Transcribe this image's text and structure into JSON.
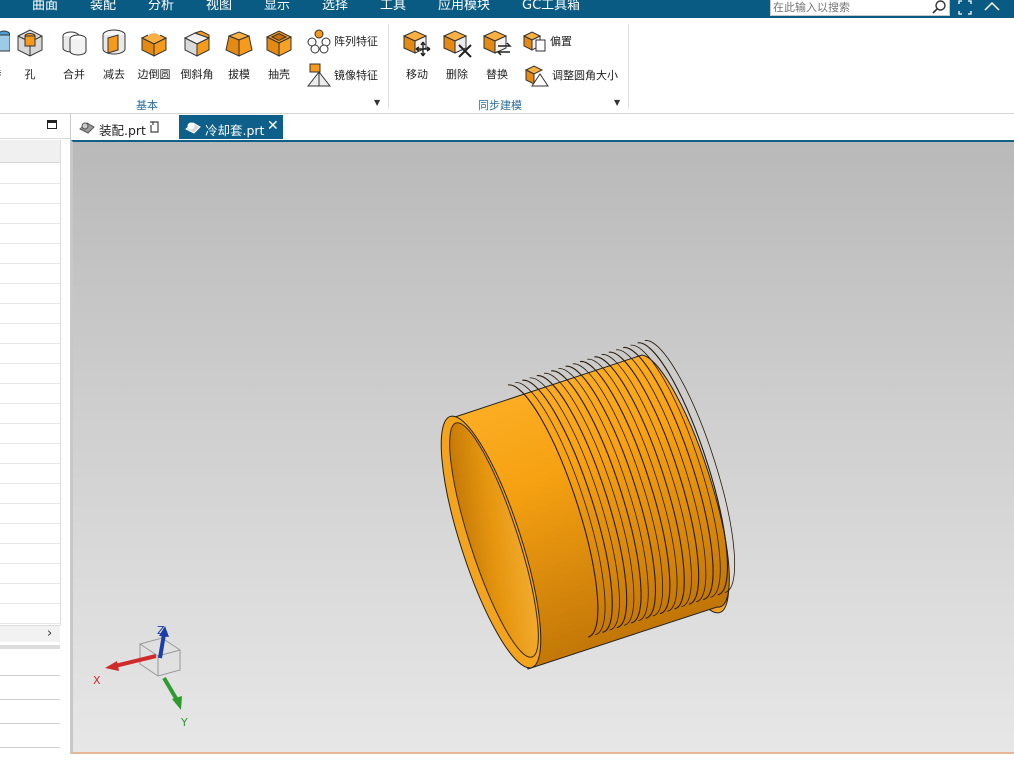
{
  "menubar": {
    "items": [
      "曲面",
      "装配",
      "分析",
      "视图",
      "显示",
      "选择",
      "工具",
      "应用模块",
      "GC工具箱"
    ],
    "search_placeholder": "在此输入以搜索"
  },
  "ribbon": {
    "groups": [
      {
        "label": "基本",
        "buttons": [
          "孔",
          "合并",
          "减去",
          "边倒圆",
          "倒斜角",
          "拔模",
          "抽壳"
        ],
        "small_buttons": [
          "阵列特征",
          "镜像特征"
        ],
        "partial_left_label": "特"
      },
      {
        "label": "同步建模",
        "buttons": [
          "移动",
          "删除",
          "替换"
        ],
        "small_buttons": [
          "偏置",
          "调整圆角大小"
        ]
      }
    ]
  },
  "tabs": [
    {
      "label": "装配.prt",
      "active": false
    },
    {
      "label": "冷却套.prt",
      "active": true
    }
  ],
  "triad": {
    "x": "X",
    "y": "Y",
    "z": "Z"
  },
  "colors": {
    "accent": "#0e5f8a",
    "menubar": "#0a5b84",
    "model_orange": "#f5a00e",
    "ribbon_group_label": "#2b6e9b"
  },
  "icons": {
    "search": "search-icon",
    "restore": "restore-window-icon",
    "collapse": "collapse-ribbon-icon",
    "maximize": "maximize-panel-icon",
    "refresh": "refresh-icon",
    "close": "close-icon",
    "part_file": "part-file-icon"
  }
}
